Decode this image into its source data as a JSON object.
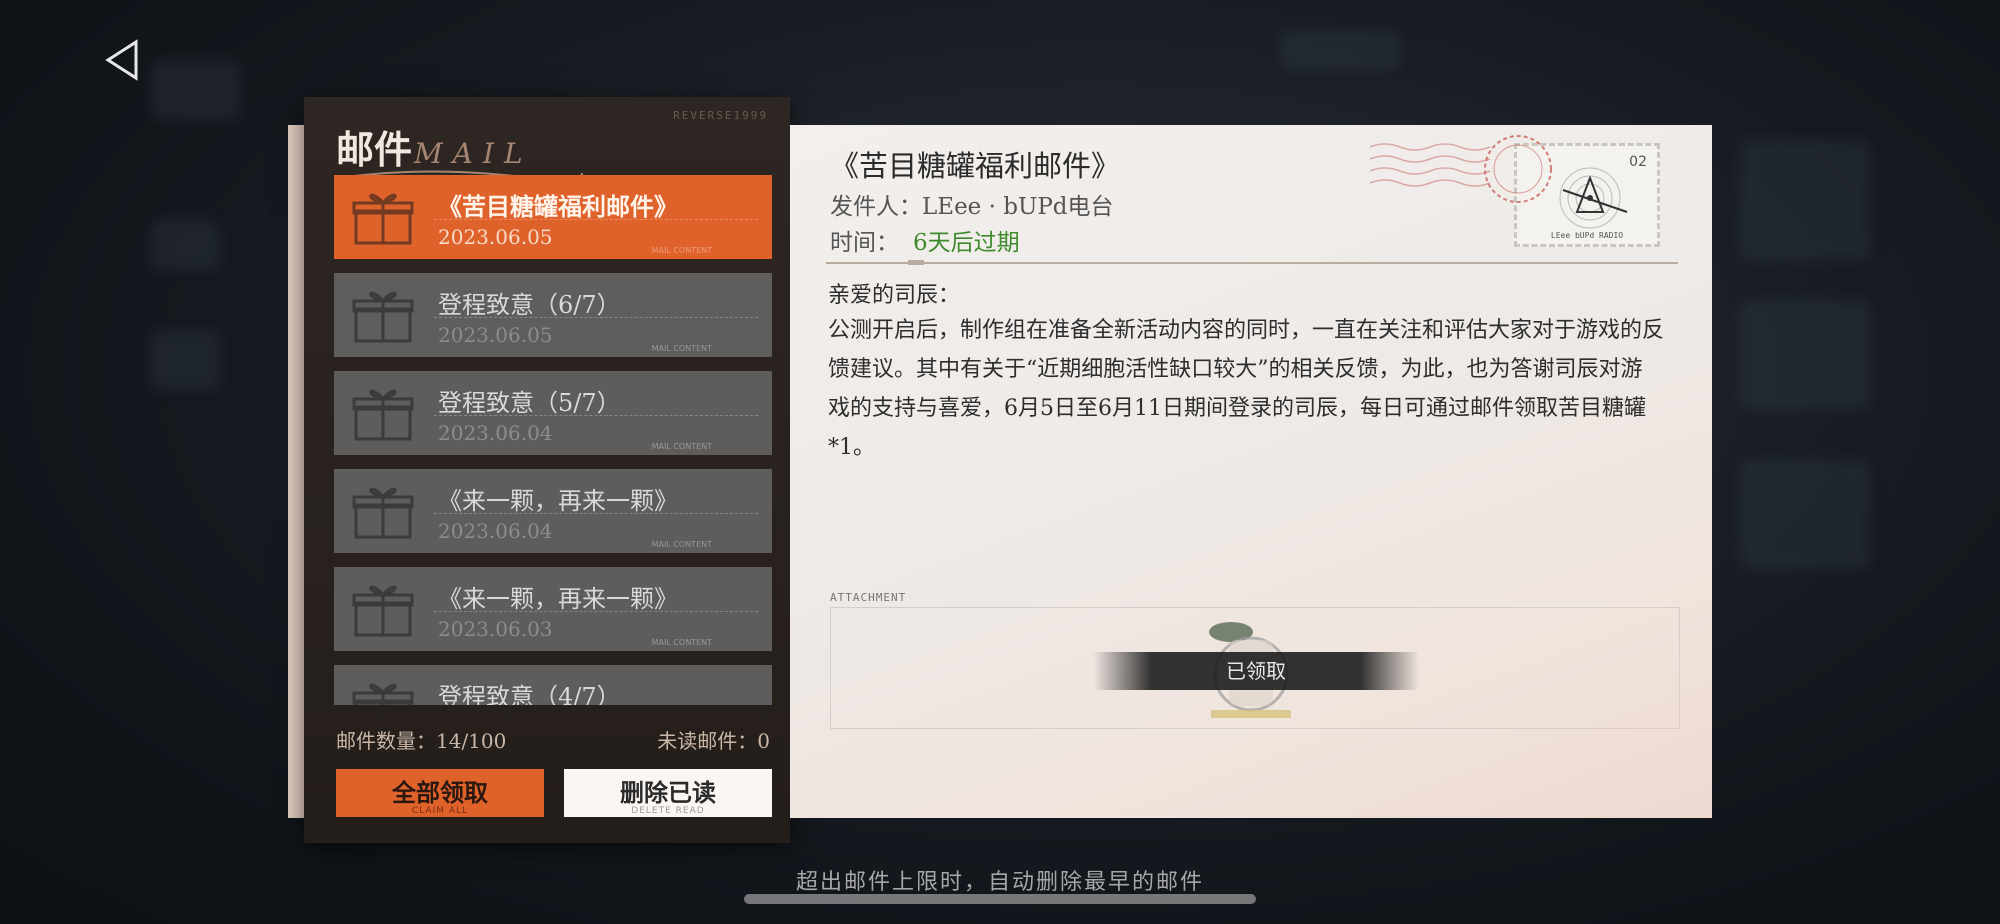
{
  "panel": {
    "brand": "REVERSE1999",
    "title": "邮件",
    "title_en": "MAIL",
    "mail_count": "邮件数量：14/100",
    "unread_count": "未读邮件：0",
    "claim_all": "全部领取",
    "claim_all_sub": "CLAIM ALL",
    "delete_read": "删除已读",
    "delete_read_sub": "DELETE READ"
  },
  "mails": [
    {
      "title": "《苦目糖罐福利邮件》",
      "date": "2023.06.05",
      "active": true
    },
    {
      "title": "登程致意（6/7）",
      "date": "2023.06.05"
    },
    {
      "title": "登程致意（5/7）",
      "date": "2023.06.04"
    },
    {
      "title": "《来一颗，再来一颗》",
      "date": "2023.06.04"
    },
    {
      "title": "《来一颗，再来一颗》",
      "date": "2023.06.03"
    },
    {
      "title": "登程致意（4/7）",
      "date": ""
    }
  ],
  "mail_tags": {
    "left": "MAIL CONTENT",
    "right": "MAIL CONTENT"
  },
  "letter": {
    "title": "《苦目糖罐福利邮件》",
    "sender_label": "发件人：",
    "sender": "LEee · bUPd电台",
    "time_label": "时间：",
    "expiry": "6天后过期",
    "greeting": "亲爱的司辰：",
    "body": "公测开启后，制作组在准备全新活动内容的同时，一直在关注和评估大家对于游戏的反馈建议。其中有关于“近期细胞活性缺口较大”的相关反馈，为此，也为答谢司辰对游戏的支持与喜爱，6月5日至6月11日期间登录的司辰，每日可通过邮件领取苦目糖罐*1。",
    "stamp_number": "02",
    "stamp_caption": "LEee  bUPd RADIO",
    "attachment_label": "ATTACHMENT",
    "claimed": "已领取"
  },
  "footer": {
    "note": "超出邮件上限时，自动删除最早的邮件"
  },
  "colors": {
    "accent": "#e0622b",
    "expiry_green": "#3e8a2c",
    "panel_bg": "#2e2622"
  }
}
